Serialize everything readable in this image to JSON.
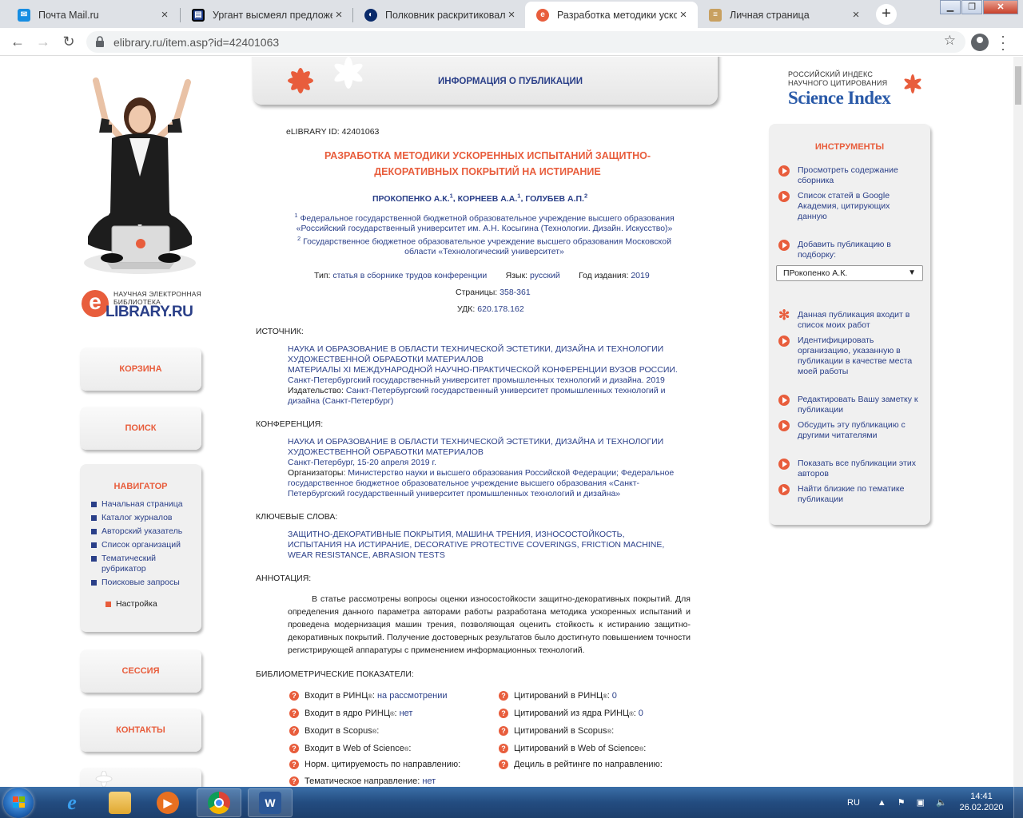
{
  "browser": {
    "tabs": [
      {
        "title": "Почта Mail.ru",
        "icon": "mail-icon",
        "color": "#168de2"
      },
      {
        "title": "Ургант высмеял предложен",
        "icon": "news-icon",
        "color": "#1a3a8a"
      },
      {
        "title": "Полковник раскритиковал",
        "icon": "news-icon",
        "color": "#0a2a6a"
      },
      {
        "title": "Разработка методики ускор",
        "icon": "elibrary-icon",
        "color": "#e85d3c"
      },
      {
        "title": "Личная страница",
        "icon": "page-icon",
        "color": "#c8a060"
      }
    ],
    "url": "elibrary.ru/item.asp?id=42401063"
  },
  "left": {
    "logo_small": "НАУЧНАЯ ЭЛЕКТРОННАЯ БИБЛИОТЕКА",
    "logo_big": "LIBRARY.RU",
    "logo_letter": "e",
    "buttons": {
      "cart": "КОРЗИНА",
      "search": "ПОИСК",
      "session": "СЕССИЯ",
      "contacts": "КОНТАКТЫ"
    },
    "navigator": {
      "title": "НАВИГАТОР",
      "items": [
        "Начальная страница",
        "Каталог журналов",
        "Авторский указатель",
        "Список организаций",
        "Тематический рубрикатор",
        "Поисковые запросы"
      ],
      "setting": "Настройка"
    }
  },
  "header": {
    "title": "ИНФОРМАЦИЯ О ПУБЛИКАЦИИ"
  },
  "publication": {
    "lib_id_label": "eLIBRARY ID:",
    "lib_id": "42401063",
    "title_line1": "РАЗРАБОТКА МЕТОДИКИ УСКОРЕННЫХ ИСПЫТАНИЙ ЗАЩИТНО-",
    "title_line2": "ДЕКОРАТИВНЫХ ПОКРЫТИЙ НА ИСТИРАНИЕ",
    "authors": [
      {
        "name": "ПРОКОПЕНКО А.К.",
        "sup": "1"
      },
      {
        "name": "КОРНЕЕВ А.А.",
        "sup": "1"
      },
      {
        "name": "ГОЛУБЕВ А.П.",
        "sup": "2"
      }
    ],
    "affiliations": [
      {
        "sup": "1",
        "text": "Федеральное государственной бюджетной образовательное учреждение высшего образования «Российский государственный университет им. А.Н. Косыгина (Технологии. Дизайн. Искусство)»"
      },
      {
        "sup": "2",
        "text": "Государственное бюджетное образовательное учреждение высшего образования Московской области «Технологический университет»"
      }
    ],
    "type_label": "Тип:",
    "type": "статья в сборнике трудов конференции",
    "lang_label": "Язык:",
    "lang": "русский",
    "year_label": "Год издания:",
    "year": "2019",
    "pages_label": "Страницы:",
    "pages": "358-361",
    "udk_label": "УДК:",
    "udk": "620.178.162",
    "source_label": "ИСТОЧНИК:",
    "source_title": "НАУКА И ОБРАЗОВАНИЕ В ОБЛАСТИ ТЕХНИЧЕСКОЙ ЭСТЕТИКИ, ДИЗАЙНА И ТЕХНОЛОГИИ ХУДОЖЕСТВЕННОЙ ОБРАБОТКИ МАТЕРИАЛОВ",
    "source_desc": "МАТЕРИАЛЫ XI МЕЖДУНАРОДНОЙ НАУЧНО-ПРАКТИЧЕСКОЙ КОНФЕРЕНЦИИ ВУЗОВ РОССИИ. Санкт-Петербургский государственный университет промышленных технологий и дизайна. 2019",
    "publisher_label": "Издательство:",
    "publisher": "Санкт-Петербургский государственный университет промышленных технологий и дизайна (Санкт-Петербург)",
    "conf_label": "КОНФЕРЕНЦИЯ:",
    "conf_title": "НАУКА И ОБРАЗОВАНИЕ В ОБЛАСТИ ТЕХНИЧЕСКОЙ ЭСТЕТИКИ, ДИЗАЙНА И ТЕХНОЛОГИИ ХУДОЖЕСТВЕННОЙ ОБРАБОТКИ МАТЕРИАЛОВ",
    "conf_place": "Санкт-Петербург, 15-20 апреля 2019 г.",
    "organizers_label": "Организаторы:",
    "organizers": "Министерство науки и высшего образования Российской Федерации; Федеральное государственное бюджетное образовательное учреждение высшего образования «Санкт-Петербургский государственный университет промышленных технологий и дизайна»",
    "keywords_label": "КЛЮЧЕВЫЕ СЛОВА:",
    "keywords": "ЗАЩИТНО-ДЕКОРАТИВНЫЕ ПОКРЫТИЯ, МАШИНА ТРЕНИЯ, ИЗНОСОСТОЙКОСТЬ, ИСПЫТАНИЯ НА ИСТИРАНИЕ, DECORATIVE PROTECTIVE COVERINGS, FRICTION MACHINE, WEAR RESISTANCE, ABRASION TESTS",
    "annotation_label": "АННОТАЦИЯ:",
    "annotation": "В статье рассмотрены вопросы оценки износостойкости защитно-декоративных покрытий. Для определения данного параметра авторами работы разработана методика ускоренных испытаний и проведена модернизация машин трения, позволяющая оценить стойкость к истиранию защитно-декоративных покрытий. Получение достоверных результатов было достигнуто повышением точности регистрирующей аппаратуры с применением информационных технологий.",
    "biblio_label": "БИБЛИОМЕТРИЧЕСКИЕ ПОКАЗАТЕЛИ:"
  },
  "metrics": {
    "left": [
      {
        "label": "Входит в РИНЦ",
        "reg": "®",
        "value": "на рассмотрении"
      },
      {
        "label": "Входит в ядро РИНЦ",
        "reg": "®",
        "value": "нет"
      },
      {
        "label": "Входит в Scopus",
        "reg": "®",
        "value": ""
      },
      {
        "label": "Входит в Web of Science",
        "reg": "®",
        "value": ""
      },
      {
        "label": "Норм. цитируемость по направлению:",
        "reg": "",
        "value": ""
      },
      {
        "label": "Тематическое направление:",
        "reg": "",
        "value": "нет"
      }
    ],
    "right": [
      {
        "label": "Цитирований в РИНЦ",
        "reg": "®",
        "value": "0"
      },
      {
        "label": "Цитирований из ядра РИНЦ",
        "reg": "®",
        "value": "0"
      },
      {
        "label": "Цитирований в Scopus",
        "reg": "®",
        "value": ""
      },
      {
        "label": "Цитирований в Web of Science",
        "reg": "®",
        "value": ""
      },
      {
        "label": "Дециль в рейтинге по направлению:",
        "reg": "",
        "value": ""
      }
    ]
  },
  "right": {
    "sci_small_1": "РОССИЙСКИЙ ИНДЕКС",
    "sci_small_2": "НАУЧНОГО ЦИТИРОВАНИЯ",
    "sci_big": "Science Index",
    "tools_title": "ИНСТРУМЕНТЫ",
    "tools": [
      "Просмотреть содержание сборника",
      "Список статей в Google Академия, цитирующих данную",
      "Добавить публикацию в подборку:",
      "Данная публикация входит в список моих работ",
      "Идентифицировать организацию, указанную в публикации в качестве места моей работы",
      "Редактировать Вашу заметку к публикации",
      "Обсудить эту публикацию с другими читателями",
      "Показать все публикации этих авторов",
      "Найти близкие по тематике публикации"
    ],
    "select_value": "ПРокопенко А.К."
  },
  "taskbar": {
    "lang": "RU",
    "time": "14:41",
    "date": "26.02.2020"
  }
}
